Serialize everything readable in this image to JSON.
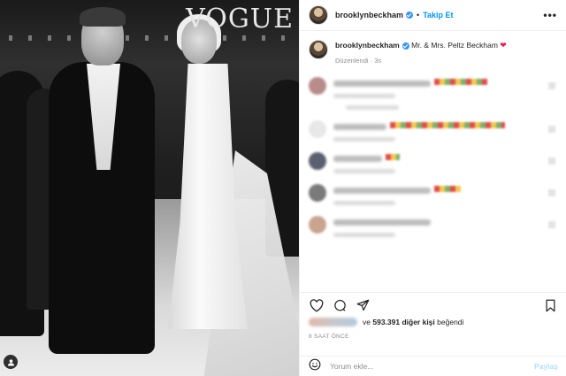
{
  "photo": {
    "magazine_watermark": "VOGUE",
    "tag_icon": "user-tag-icon"
  },
  "header": {
    "username": "brooklynbeckham",
    "separator": "•",
    "follow_label": "Takip Et",
    "more_icon": "more-options-icon",
    "more_label": "•••"
  },
  "caption": {
    "username": "brooklynbeckham",
    "text": "Mr. & Mrs. Peltz Beckham",
    "emoji_icon": "red-heart-icon",
    "emoji": "❤",
    "edited_label": "Düzenlendi · 3s"
  },
  "comments": [
    {
      "avatar_color": "#b98c8c"
    },
    {
      "avatar_color": "#e8e8e8"
    },
    {
      "avatar_color": "#5a6070"
    },
    {
      "avatar_color": "#7a7a7a"
    },
    {
      "avatar_color": "#c9a48f"
    }
  ],
  "actions": {
    "like_icon": "heart-outline-icon",
    "comment_icon": "comment-bubble-icon",
    "share_icon": "paper-plane-icon",
    "save_icon": "bookmark-icon"
  },
  "likes": {
    "prefix": "ve",
    "count": "593.391 diğer kişi",
    "suffix": "beğendi"
  },
  "timestamp": "8 SAAT ÖNCE",
  "add_comment": {
    "emoji_icon": "smiley-icon",
    "placeholder": "Yorum ekle...",
    "post_label": "Paylaş"
  },
  "colors": {
    "follow_blue": "#0095f6",
    "verified_blue": "#3897f0",
    "heart_red": "#e0245e",
    "muted_text": "#8e8e8e"
  }
}
